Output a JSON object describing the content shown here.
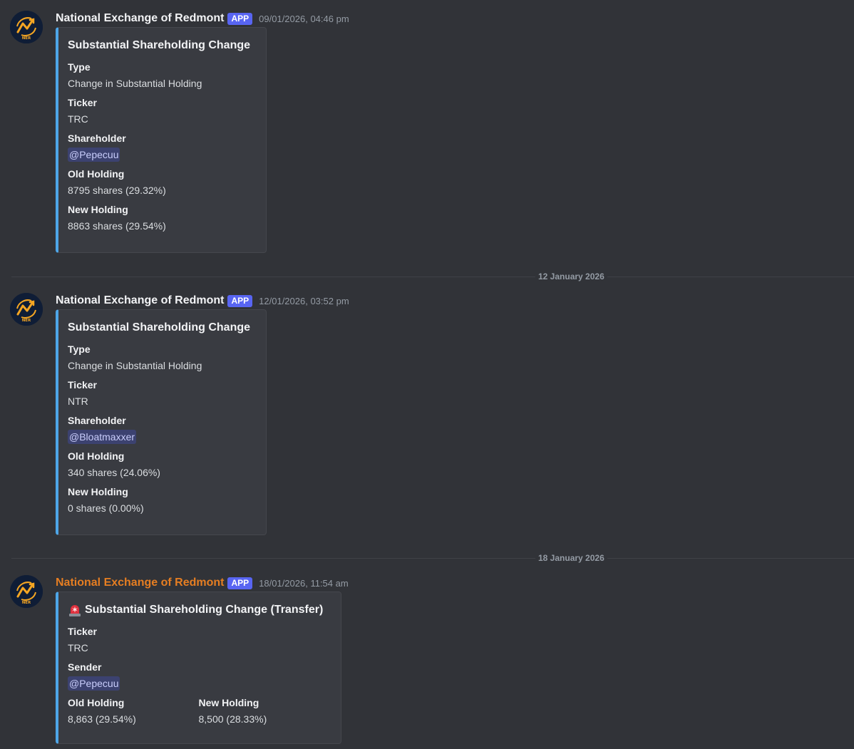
{
  "messages": [
    {
      "author": "National Exchange of Redmont",
      "badge": "APP",
      "timestamp": "09/01/2026, 04:46 pm",
      "avatar_text": "NER",
      "embed": {
        "title": "Substantial Shareholding Change",
        "fields": [
          {
            "name": "Type",
            "value": "Change in Substantial Holding"
          },
          {
            "name": "Ticker",
            "value": "TRC"
          },
          {
            "name": "Shareholder",
            "value": "@Pepecuu"
          },
          {
            "name": "Old Holding",
            "value": "8795 shares (29.32%)"
          },
          {
            "name": "New Holding",
            "value": "8863 shares (29.54%)"
          }
        ]
      }
    },
    {
      "author": "National Exchange of Redmont",
      "badge": "APP",
      "timestamp": "12/01/2026, 03:52 pm",
      "avatar_text": "NER",
      "embed": {
        "title": "Substantial Shareholding Change",
        "fields": [
          {
            "name": "Type",
            "value": "Change in Substantial Holding"
          },
          {
            "name": "Ticker",
            "value": "NTR"
          },
          {
            "name": "Shareholder",
            "value": "@Bloatmaxxer"
          },
          {
            "name": "Old Holding",
            "value": "340 shares (24.06%)"
          },
          {
            "name": "New Holding",
            "value": "0 shares (0.00%)"
          }
        ]
      }
    },
    {
      "author": "National Exchange of Redmont",
      "badge": "APP",
      "timestamp": "18/01/2026, 11:54 am",
      "avatar_text": "NER",
      "author_color": "#e67e22",
      "embed": {
        "title": "Substantial Shareholding Change (Transfer)",
        "fields": [
          {
            "name": "Ticker",
            "value": "TRC"
          },
          {
            "name": "Sender",
            "value": "@Pepecuu"
          },
          {
            "name": "Old Holding",
            "value": "8,863 (29.54%)"
          },
          {
            "name": "New Holding",
            "value": "8,500 (28.33%)"
          }
        ]
      }
    }
  ],
  "dividers": [
    {
      "label": "12 January 2026"
    },
    {
      "label": "18 January 2026"
    }
  ],
  "colors": {
    "background": "#313338",
    "embed_accent": "#4ea6e8",
    "app_badge": "#5865f2",
    "mention_bg": "#3c4270",
    "orange_author": "#e67e22"
  },
  "icons": {
    "avatar": "ner-logo-icon",
    "siren": "rotating-light-icon"
  }
}
